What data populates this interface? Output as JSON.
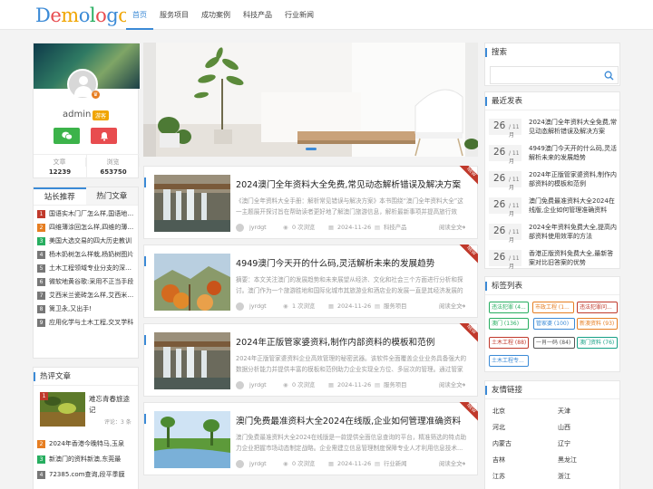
{
  "header": {
    "logo_text": "Demologo",
    "nav": [
      {
        "label": "首页"
      },
      {
        "label": "服务项目"
      },
      {
        "label": "成功案例"
      },
      {
        "label": "科技产品"
      },
      {
        "label": "行业新闻"
      }
    ]
  },
  "profile": {
    "name": "admin",
    "level_badge": "游客",
    "stats": [
      {
        "label": "文章",
        "value": "12239"
      },
      {
        "label": "浏览",
        "value": "653750"
      }
    ]
  },
  "rec_tabs": [
    {
      "label": "站长推荐"
    },
    {
      "label": "热门文章"
    }
  ],
  "rec_list": [
    {
      "rank": "1",
      "title": "国语实木门厂怎么样,国语地板怎么样",
      "color": "#c0392b"
    },
    {
      "rank": "2",
      "title": "四维薄涂回怎么样,四维的薄涂怎么样",
      "color": "#e67e22"
    },
    {
      "rank": "3",
      "title": "美国大选交易的四大历史教训",
      "color": "#27ae60"
    },
    {
      "rank": "4",
      "title": "杨木奶树怎么样栽,杨奶树图片",
      "color": "#777"
    },
    {
      "rank": "5",
      "title": "土木工程领域专业分支的深度解析",
      "color": "#777"
    },
    {
      "rank": "6",
      "title": "微软地黄谷歌:采用不正当手段",
      "color": "#777"
    },
    {
      "rank": "7",
      "title": "艾西米兰瓷砖怎么样,艾西米兰瓷砖",
      "color": "#777"
    },
    {
      "rank": "8",
      "title": "篱卫永,又出手!",
      "color": "#777"
    },
    {
      "rank": "9",
      "title": "应用化学与土木工程,交叉学科",
      "color": "#777"
    }
  ],
  "hot": {
    "title": "热评文章",
    "featured": {
      "rank": "1",
      "title": "难忘青春旅途记",
      "comments": "评论：3 条"
    },
    "items": [
      {
        "rank": "2",
        "title": "2024年香港今晚特马,玉泉",
        "color": "#e67e22"
      },
      {
        "rank": "3",
        "title": "新澳门的资料新澳,东莞最",
        "color": "#27ae60"
      },
      {
        "rank": "4",
        "title": "72385.com查询,段平季膜",
        "color": "#777"
      }
    ]
  },
  "articles": [
    {
      "title": "2024澳门全年资料大全免费,常见动态解析错误及解决方案",
      "summary": "《澳门全年资料大全手册：解析常见错误与解决方案》本书围绕“澳门全年资料大全”这一主题展开探讨旨在帮助读者更好地了解澳门旅游信息，解析最新事项并提高旅行效率。",
      "author": "jyrdgt",
      "views": "0 次浏览",
      "date": "2024-11-26",
      "category": "科技产品",
      "more": "阅读全文",
      "new_tag": "NEW"
    },
    {
      "title": "4949澳门今天开的什么码,灵活解析未来的发展趋势",
      "summary": "摘要：本文关注澳门的发展趋势和未来展望从经济、文化和社会三个方面进行分析和探讨。澳门作为一个旅游胜地和国际化城市其旅游业和酒店业的发展一直是其经济发展的重要支柱。",
      "author": "jyrdgt",
      "views": "1 次浏览",
      "date": "2024-11-26",
      "category": "服务项目",
      "more": "阅读全文",
      "new_tag": "NEW"
    },
    {
      "title": "2024年正版管家婆资料,制作内部资料的模板和范例",
      "summary": "2024年正版管家婆资料企业高效管理的秘密武器。该软件全面覆盖企业业务具备强大的数据分析能力并提供丰富的模板和范例助力企业实现全方位、多层次的管理。通过管家婆...",
      "author": "jyrdgt",
      "views": "0 次浏览",
      "date": "2024-11-26",
      "category": "服务项目",
      "more": "阅读全文",
      "new_tag": "NEW"
    },
    {
      "title": "澳门免费最准资料大全2024在线版,企业如何管理准确资料",
      "summary": "澳门免费最准资料大全2024在线版是一款提供全面信息查询的平台，精准筛选的特点助力企业把握市场动态制定战略。企业需建立信息管理制度保障专业人才利用信息技术...",
      "author": "jyrdgt",
      "views": "0 次浏览",
      "date": "2024-11-26",
      "category": "行业新闻",
      "more": "阅读全文",
      "new_tag": "NEW"
    }
  ],
  "search": {
    "title": "搜索",
    "placeholder": ""
  },
  "latest": {
    "title": "最近发表",
    "items": [
      {
        "day": "26",
        "month": "/ 11月",
        "title": "2024澳门全年资料大全免费,常见动态解析错误及解决方案"
      },
      {
        "day": "26",
        "month": "/ 11月",
        "title": "4949澳门今天开的什么码,灵活解析未来的发展趋势"
      },
      {
        "day": "26",
        "month": "/ 11月",
        "title": "2024年正版管家婆资料,制作内部资料的模板和范例"
      },
      {
        "day": "26",
        "month": "/ 11月",
        "title": "澳门免费最准资料大全2024在线版,企业如何管理准确资料"
      },
      {
        "day": "26",
        "month": "/ 11月",
        "title": "2024全年资料免费大全,提高内部资料使用效率的方法"
      },
      {
        "day": "26",
        "month": "/ 11月",
        "title": "香港正版资料免费大全,最新答案对比旧答案的优势"
      }
    ]
  },
  "tags": {
    "title": "标签列表",
    "items": [
      {
        "label": "违法犯罪 (4...",
        "color": "#27ae60"
      },
      {
        "label": "市政工程 (1...",
        "color": "#e67e22"
      },
      {
        "label": "违法犯罪问...",
        "color": "#c0392b"
      },
      {
        "label": "澳门 (136)",
        "color": "#27ae60"
      },
      {
        "label": "管家婆 (100)",
        "color": "#3b8ad6"
      },
      {
        "label": "新澳资料 (93)",
        "color": "#e67e22"
      },
      {
        "label": "土木工程 (88)",
        "color": "#c0392b"
      },
      {
        "label": "一肖一码 (84)",
        "color": "#555"
      },
      {
        "label": "澳门资料 (76)",
        "color": "#16a085"
      },
      {
        "label": "土木工程专...",
        "color": "#3b8ad6"
      }
    ]
  },
  "links": {
    "title": "友情链接",
    "items": [
      "北京",
      "天津",
      "河北",
      "山西",
      "内蒙古",
      "辽宁",
      "吉林",
      "黑龙江",
      "江苏",
      "浙江"
    ]
  }
}
